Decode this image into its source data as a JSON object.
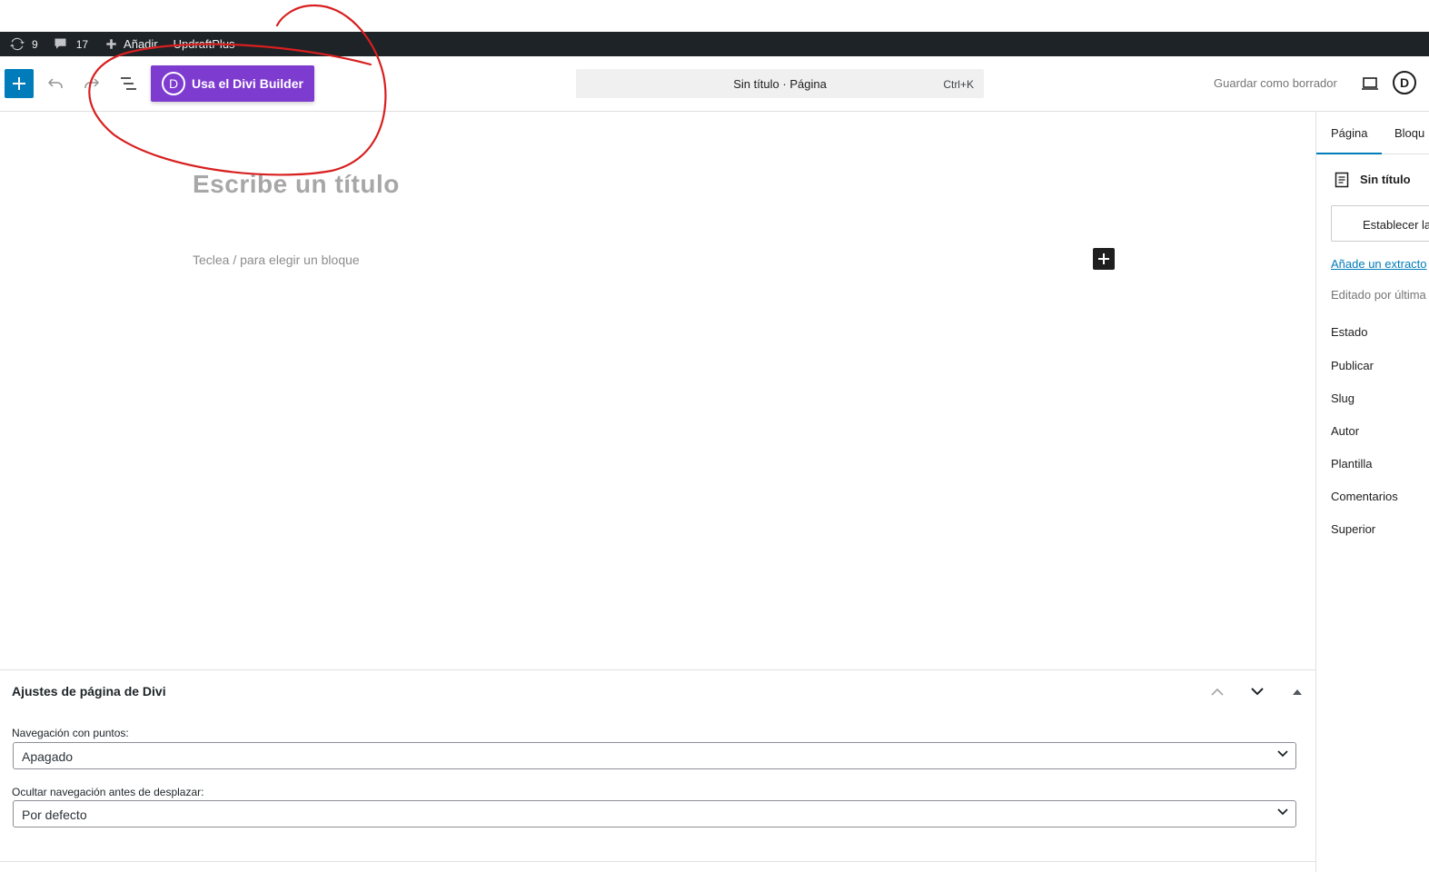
{
  "admin_bar": {
    "updates_count": "9",
    "comments_count": "17",
    "new_label": "Añadir",
    "plugin_label": "UpdraftPlus"
  },
  "header": {
    "divi_button_label": "Usa el Divi Builder",
    "divi_letter": "D",
    "command_title": "Sin título · Página",
    "command_shortcut": "Ctrl+K",
    "save_draft_label": "Guardar como borrador",
    "divi_round_letter": "D"
  },
  "canvas": {
    "title_placeholder": "Escribe un título",
    "block_placeholder": "Teclea / para elegir un bloque"
  },
  "sidebar": {
    "tabs": [
      {
        "label": "Página",
        "active": true
      },
      {
        "label": "Bloqu",
        "active": false
      }
    ],
    "doc_title": "Sin título",
    "featured_image_button": "Establecer la",
    "excerpt_link": "Añade un extracto",
    "edited_by": "Editado por última",
    "rows": [
      "Estado",
      "Publicar",
      "Slug",
      "Autor",
      "Plantilla",
      "Comentarios",
      "Superior"
    ]
  },
  "metabox": {
    "title": "Ajustes de página de Divi",
    "fields": [
      {
        "label": "Navegación con puntos:",
        "value": "Apagado"
      },
      {
        "label": "Ocultar navegación antes de desplazar:",
        "value": "Por defecto"
      }
    ]
  },
  "colors": {
    "admin_bar": "#1d2327",
    "accent": "#007cba",
    "divi_purple": "#7e3bd0",
    "annotation": "#d81f1f"
  }
}
